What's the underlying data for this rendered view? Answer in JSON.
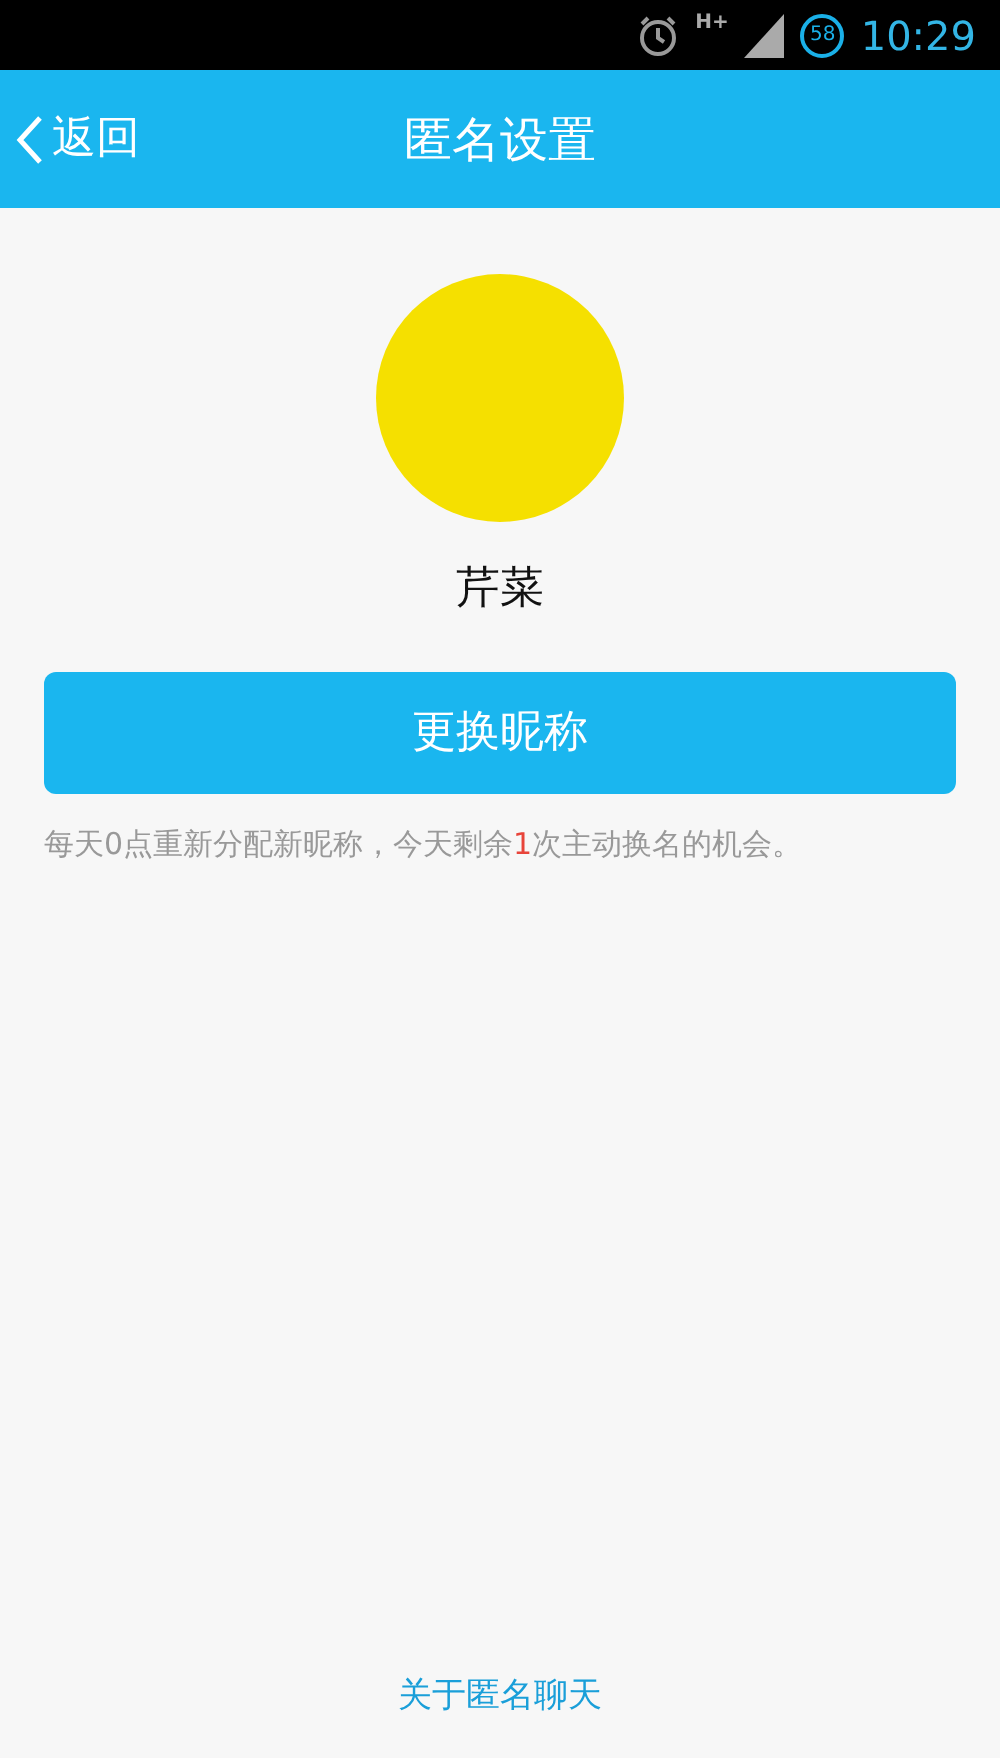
{
  "status_bar": {
    "network": "H+",
    "battery": "58",
    "time": "10:29"
  },
  "nav": {
    "back": "返回",
    "title": "匿名设置"
  },
  "profile": {
    "nickname": "芹菜"
  },
  "change_button": "更换昵称",
  "notice": {
    "before": "每天0点重新分配新昵称，今天剩余",
    "count": "1",
    "after": "次主动换名的机会。"
  },
  "footer_link": "关于匿名聊天"
}
